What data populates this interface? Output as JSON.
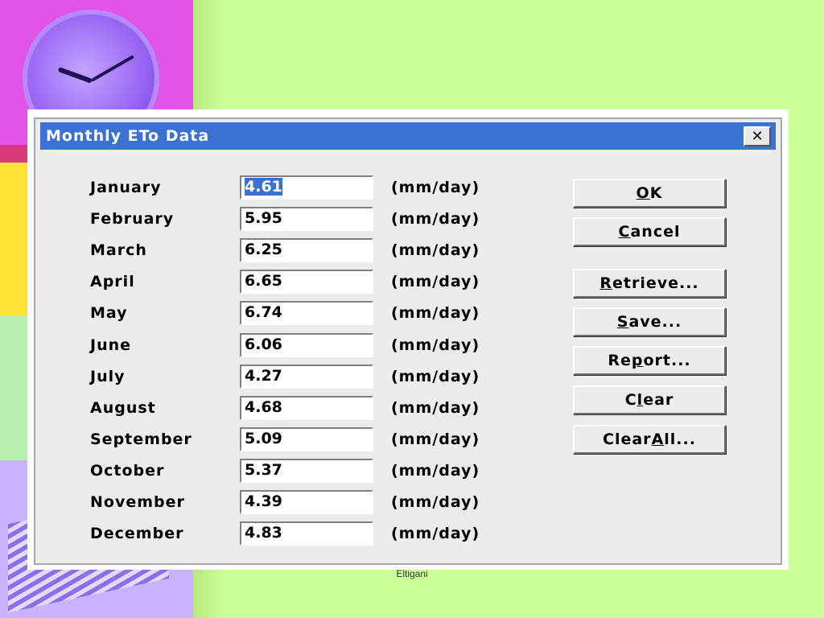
{
  "dialog": {
    "title": "Monthly ETo Data",
    "close_icon": "close-x-icon"
  },
  "months": [
    {
      "label": "January",
      "value": "4.61",
      "unit": "(mm/day)",
      "selected": true
    },
    {
      "label": "February",
      "value": "5.95",
      "unit": "(mm/day)"
    },
    {
      "label": "March",
      "value": "6.25",
      "unit": "(mm/day)"
    },
    {
      "label": "April",
      "value": "6.65",
      "unit": "(mm/day)"
    },
    {
      "label": "May",
      "value": "6.74",
      "unit": "(mm/day)"
    },
    {
      "label": "June",
      "value": "6.06",
      "unit": "(mm/day)"
    },
    {
      "label": "July",
      "value": "4.27",
      "unit": "(mm/day)"
    },
    {
      "label": "August",
      "value": "4.68",
      "unit": "(mm/day)"
    },
    {
      "label": "September",
      "value": "5.09",
      "unit": "(mm/day)"
    },
    {
      "label": "October",
      "value": "5.37",
      "unit": "(mm/day)"
    },
    {
      "label": "November",
      "value": "4.39",
      "unit": "(mm/day)"
    },
    {
      "label": "December",
      "value": "4.83",
      "unit": "(mm/day)"
    }
  ],
  "buttons": [
    {
      "name": "ok-button",
      "pre": "",
      "key": "O",
      "post": "K"
    },
    {
      "name": "cancel-button",
      "pre": "",
      "key": "C",
      "post": "ancel"
    },
    {
      "name": "retrieve-button",
      "pre": "",
      "key": "R",
      "post": "etrieve..."
    },
    {
      "name": "save-button",
      "pre": "",
      "key": "S",
      "post": "ave..."
    },
    {
      "name": "report-button",
      "pre": "Re",
      "key": "p",
      "post": "ort..."
    },
    {
      "name": "clear-button",
      "pre": "C",
      "key": "l",
      "post": "ear"
    },
    {
      "name": "clear-all-button",
      "pre": "Clear ",
      "key": "A",
      "post": "ll..."
    }
  ],
  "footer": {
    "text": "Eltigani"
  },
  "colors": {
    "titlebar": "#3b72d1",
    "background": "#ccff99",
    "dialog": "#ececec"
  }
}
